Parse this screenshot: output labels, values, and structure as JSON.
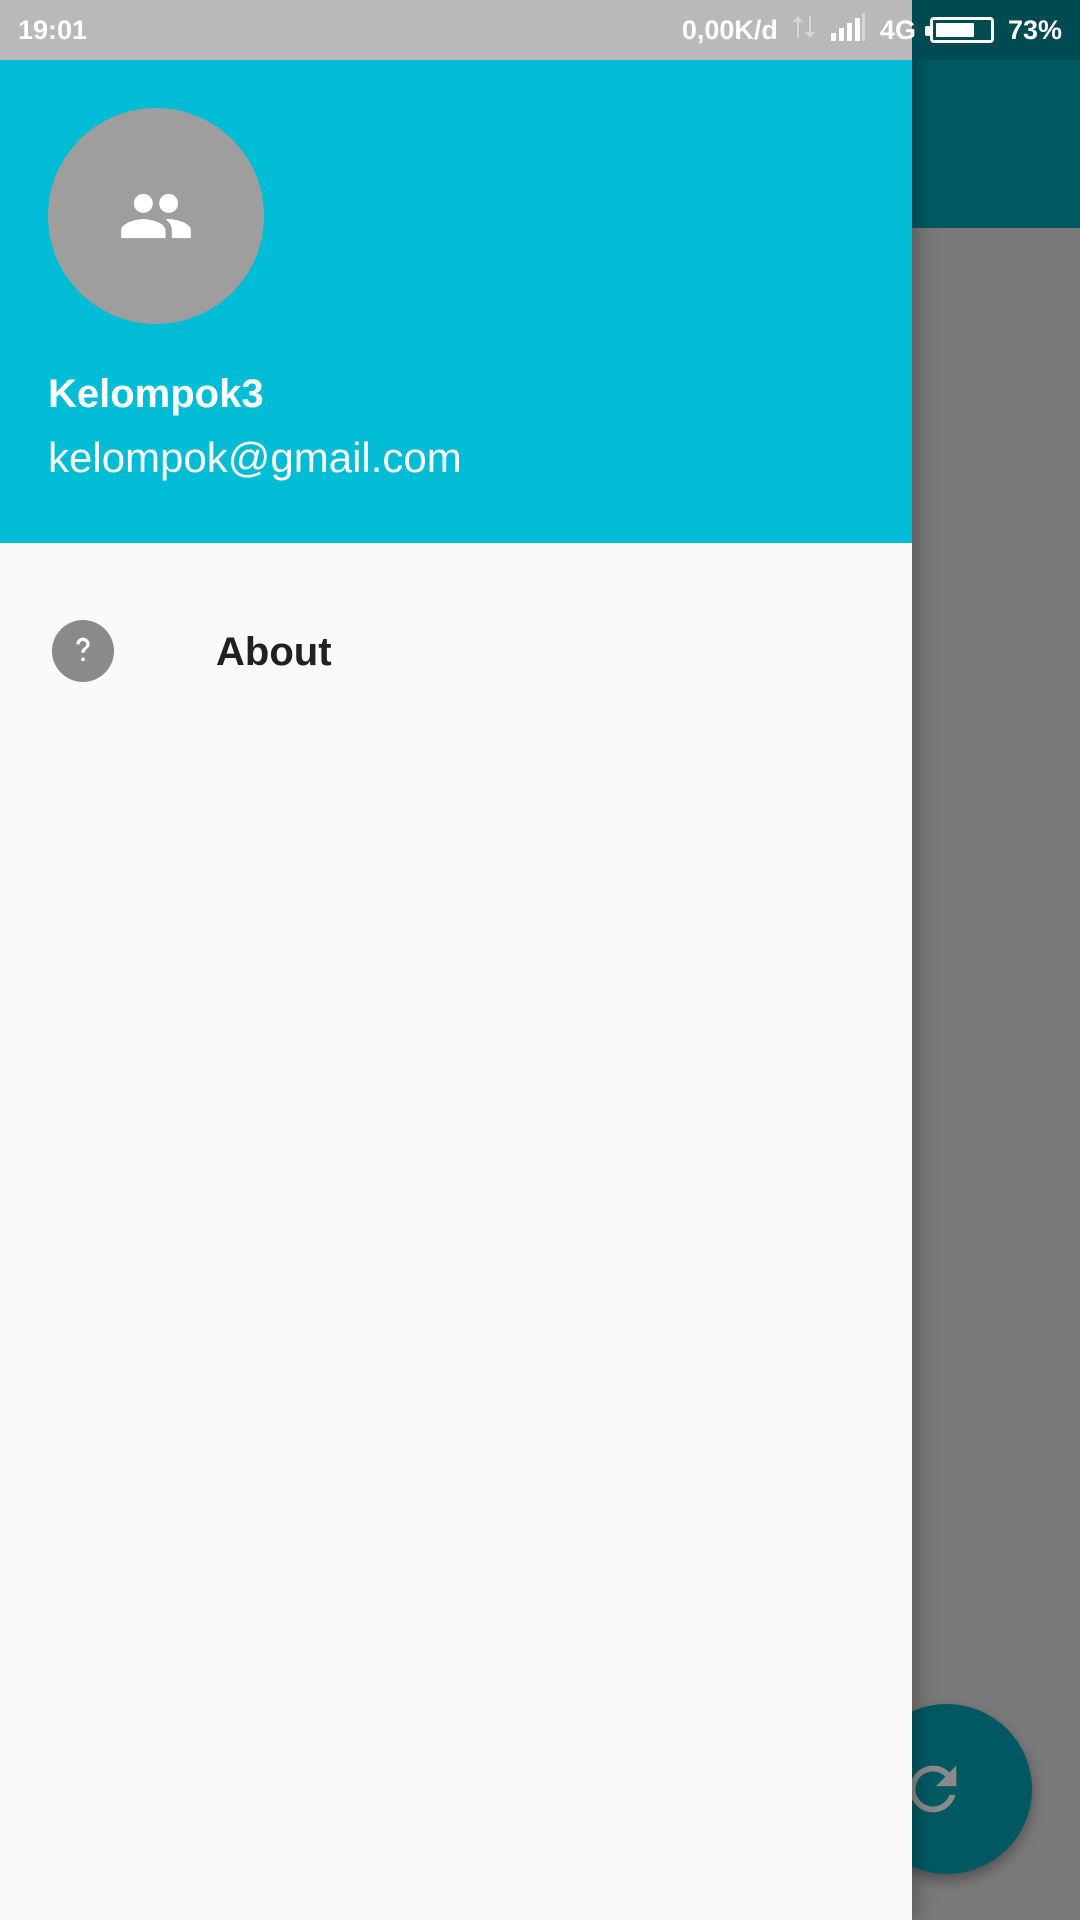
{
  "status_bar": {
    "time": "19:01",
    "net_speed": "0,00K/d",
    "network_type": "4G",
    "battery_percent": "73%",
    "battery_level": 0.73,
    "icons": [
      "data-arrows-icon",
      "signal-icon",
      "battery-icon"
    ]
  },
  "drawer": {
    "header": {
      "avatar_icon": "group-icon",
      "name": "Kelompok3",
      "email": "kelompok@gmail.com"
    },
    "menu": [
      {
        "icon": "help-icon",
        "label": "About"
      }
    ]
  },
  "background_app": {
    "fab_icon": "refresh-icon"
  },
  "colors": {
    "header": "#00bcd4",
    "toolbar": "#005962",
    "drawer_bg": "#fafafa",
    "scrim": "#7a7a7a",
    "avatar": "#9e9e9e"
  }
}
